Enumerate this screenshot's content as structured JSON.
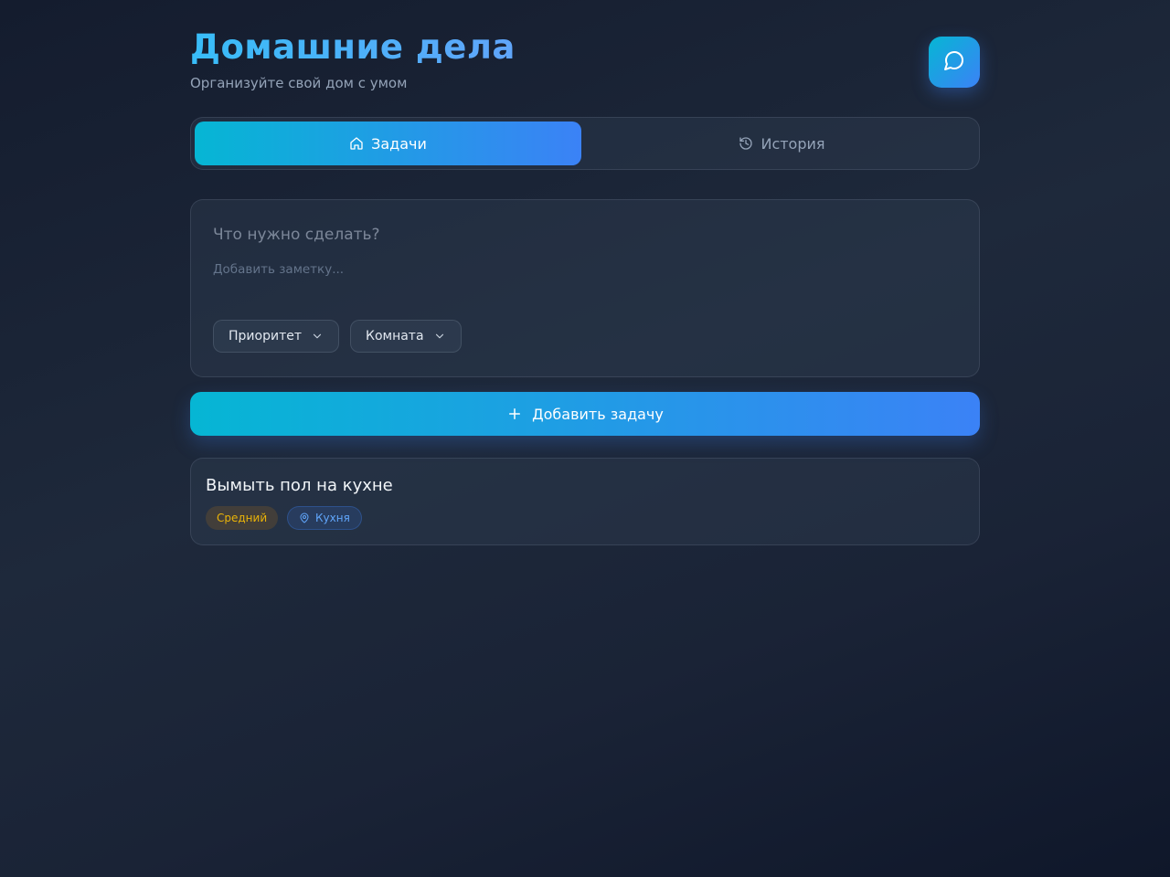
{
  "header": {
    "title": "Домашние дела",
    "subtitle": "Организуйте свой дом с умом",
    "chat_icon": "message-circle-icon"
  },
  "tabs": [
    {
      "label": "Задачи",
      "icon": "home-icon",
      "active": true
    },
    {
      "label": "История",
      "icon": "history-icon",
      "active": false
    }
  ],
  "form": {
    "task_placeholder": "Что нужно сделать?",
    "task_value": "",
    "note_placeholder": "Добавить заметку...",
    "note_value": "",
    "priority_label": "Приоритет",
    "room_label": "Комната"
  },
  "add_button": {
    "label": "Добавить задачу",
    "icon": "plus-icon"
  },
  "tasks": [
    {
      "title": "Вымыть пол на кухне",
      "priority": "Средний",
      "room": "Кухня",
      "room_icon": "map-pin-icon"
    }
  ],
  "colors": {
    "accent_start": "#06b6d4",
    "accent_end": "#3b82f6",
    "priority_medium": "#eab308",
    "room_badge": "#60a5fa",
    "background": "#1e293b"
  }
}
